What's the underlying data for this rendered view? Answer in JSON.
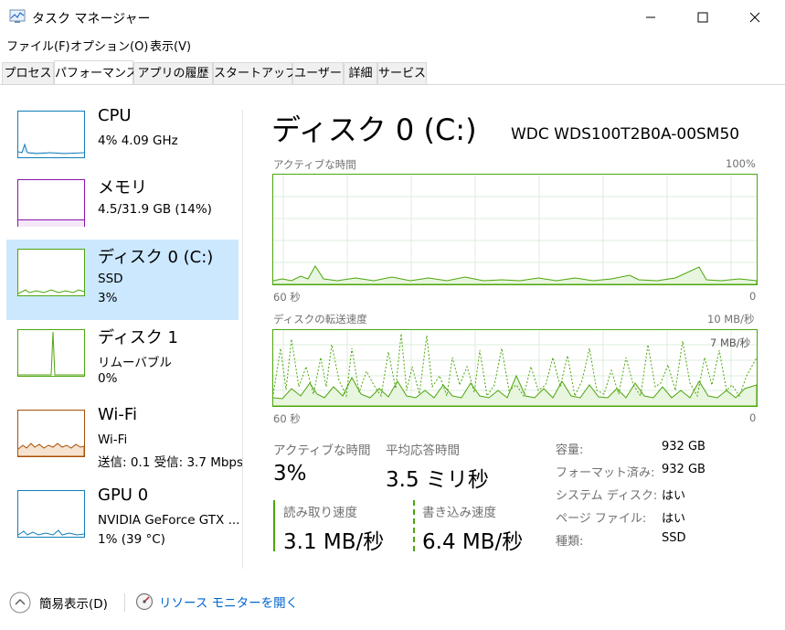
{
  "window": {
    "title": "タスク マネージャー",
    "controls": {
      "minimize": "—",
      "maximize": "☐",
      "close": "✕"
    }
  },
  "menu": [
    "ファイル(F)",
    "オプション(O)",
    "表示(V)"
  ],
  "tabs": [
    "プロセス",
    "パフォーマンス",
    "アプリの履歴",
    "スタートアップ",
    "ユーザー",
    "詳細",
    "サービス"
  ],
  "active_tab": "パフォーマンス",
  "sidebar": {
    "items": [
      {
        "name": "CPU",
        "line1": "4%  4.09 GHz",
        "line2": "",
        "color": "#117dbb"
      },
      {
        "name": "メモリ",
        "line1": "4.5/31.9 GB (14%)",
        "line2": "",
        "color": "#8b12ae"
      },
      {
        "name": "ディスク 0 (C:)",
        "line1": "SSD",
        "line2": "3%",
        "color": "#4da60c"
      },
      {
        "name": "ディスク 1",
        "line1": "リムーバブル",
        "line2": "0%",
        "color": "#4da60c"
      },
      {
        "name": "Wi-Fi",
        "line1": "Wi-Fi",
        "line2": "送信: 0.1  受信: 3.7 Mbps",
        "color": "#a74f01"
      },
      {
        "name": "GPU 0",
        "line1": "NVIDIA GeForce GTX ...",
        "line2": "1% (39 °C)",
        "color": "#117dbb"
      }
    ],
    "selected": 2
  },
  "main": {
    "title": "ディスク 0 (C:)",
    "model": "WDC  WDS100T2B0A-00SM50",
    "graph1": {
      "label": "アクティブな時間",
      "max": "100%",
      "time": "60 秒",
      "min": "0"
    },
    "graph2": {
      "label": "ディスクの転送速度",
      "max": "10 MB/秒",
      "inner": "7 MB/秒",
      "time": "60 秒",
      "min": "0"
    },
    "stats": {
      "active_label": "アクティブな時間",
      "active_value": "3%",
      "resp_label": "平均応答時間",
      "resp_value": "3.5 ミリ秒",
      "read_label": "読み取り速度",
      "read_value": "3.1 MB/秒",
      "write_label": "書き込み速度",
      "write_value": "6.4 MB/秒"
    },
    "props": [
      {
        "label": "容量:",
        "value": "932 GB"
      },
      {
        "label": "フォーマット済み:",
        "value": "932 GB"
      },
      {
        "label": "システム ディスク:",
        "value": "はい"
      },
      {
        "label": "ページ ファイル:",
        "value": "はい"
      },
      {
        "label": "種類:",
        "value": "SSD"
      }
    ]
  },
  "bottom": {
    "fewer_details": "簡易表示(D)",
    "resource_monitor": "リソース モニターを開く"
  }
}
